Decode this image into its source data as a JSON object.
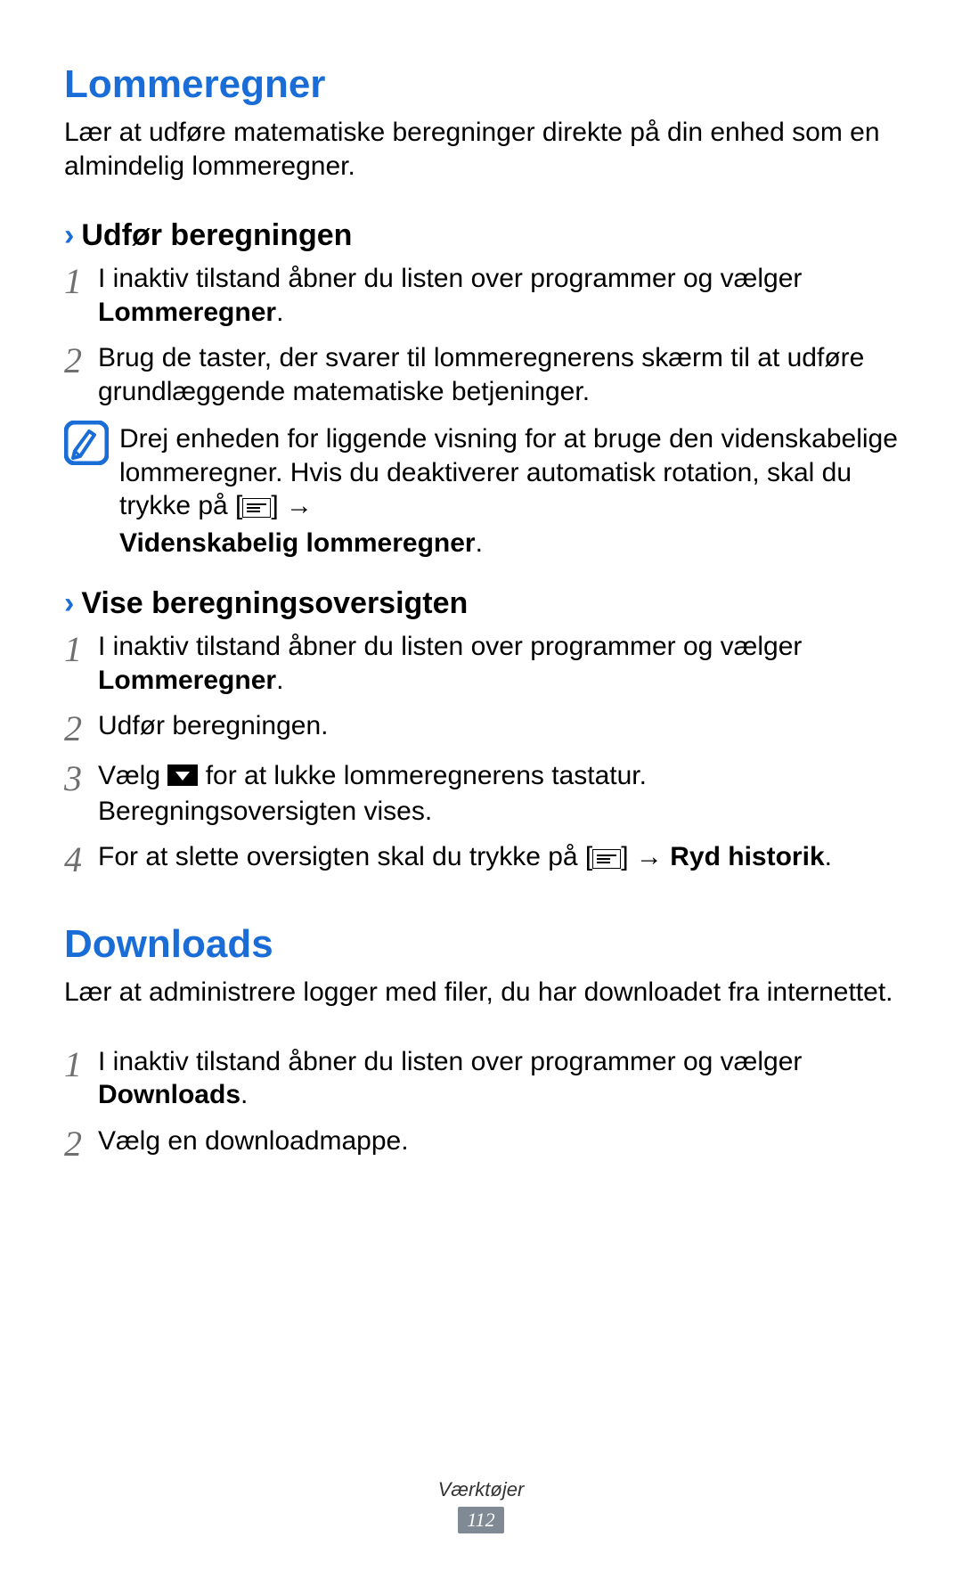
{
  "section1": {
    "title": "Lommeregner",
    "intro": "Lær at udføre matematiske beregninger direkte på din enhed som en almindelig lommeregner.",
    "sub1": {
      "heading": "Udfør beregningen",
      "step1_a": "I inaktiv tilstand åbner du listen over programmer og vælger ",
      "step1_b": "Lommeregner",
      "step1_c": ".",
      "step2": "Brug de taster, der svarer til lommeregnerens skærm til at udføre grundlæggende matematiske betjeninger.",
      "note_a": "Drej enheden for liggende visning for at bruge den videnskabelige lommeregner. Hvis du deaktiverer automatisk rotation, skal du trykke på [",
      "note_b": "] → ",
      "note_c": "Videnskabelig lommeregner",
      "note_d": "."
    },
    "sub2": {
      "heading": "Vise beregningsoversigten",
      "step1_a": "I inaktiv tilstand åbner du listen over programmer og vælger ",
      "step1_b": "Lommeregner",
      "step1_c": ".",
      "step2": "Udfør beregningen.",
      "step3_a": "Vælg ",
      "step3_b": " for at lukke lommeregnerens tastatur. Beregningsoversigten vises.",
      "step4_a": "For at slette oversigten skal du trykke på [",
      "step4_b": "] → ",
      "step4_c": "Ryd historik",
      "step4_d": "."
    }
  },
  "section2": {
    "title": "Downloads",
    "intro": "Lær at administrere logger med filer, du har downloadet fra internettet.",
    "step1_a": "I inaktiv tilstand åbner du listen over programmer og vælger ",
    "step1_b": "Downloads",
    "step1_c": ".",
    "step2": "Vælg en downloadmappe."
  },
  "footer": {
    "section_label": "Værktøjer",
    "page_num": "112"
  },
  "nums": {
    "n1": "1",
    "n2": "2",
    "n3": "3",
    "n4": "4"
  }
}
